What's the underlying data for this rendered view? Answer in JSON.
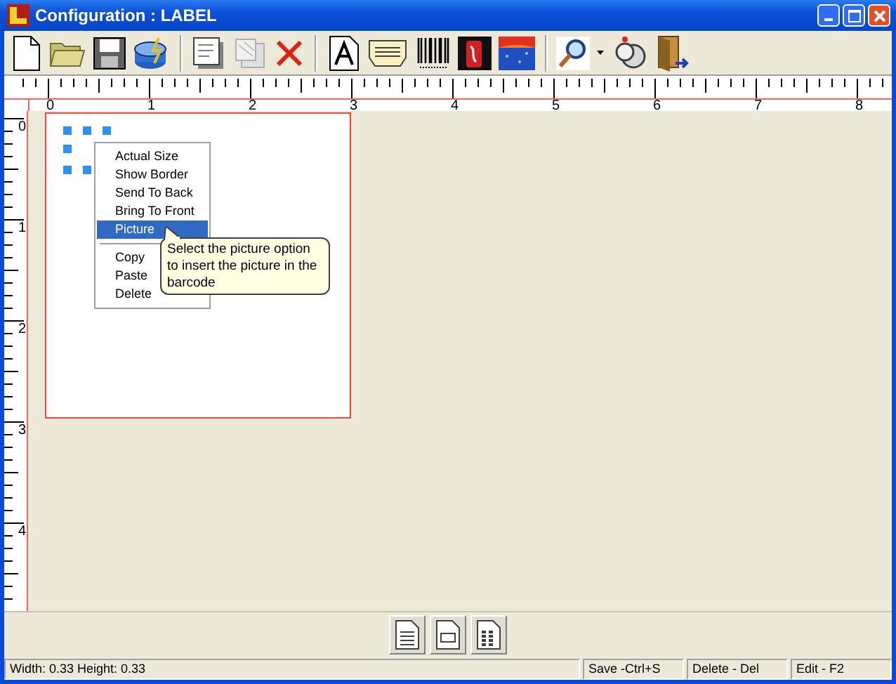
{
  "window": {
    "title": "Configuration : LABEL"
  },
  "ruler_horizontal": {
    "labels": [
      "0",
      "1",
      "2",
      "3",
      "4",
      "5",
      "6",
      "7",
      "8"
    ]
  },
  "ruler_vertical": {
    "labels": [
      "0",
      "1",
      "2",
      "3",
      "4"
    ]
  },
  "context_menu": {
    "items": [
      {
        "kind": "item",
        "label": "Actual Size",
        "selected": false
      },
      {
        "kind": "item",
        "label": "Show Border",
        "selected": false
      },
      {
        "kind": "item",
        "label": "Send To Back",
        "selected": false
      },
      {
        "kind": "item",
        "label": "Bring To Front",
        "selected": false
      },
      {
        "kind": "item",
        "label": "Picture",
        "selected": true
      },
      {
        "kind": "separator"
      },
      {
        "kind": "item",
        "label": "Copy",
        "selected": false
      },
      {
        "kind": "item",
        "label": "Paste",
        "selected": false
      },
      {
        "kind": "item",
        "label": "Delete",
        "selected": false
      }
    ]
  },
  "tooltip": {
    "text": "Select the picture option to insert the picture in the barcode"
  },
  "status_bar": [
    "Width: 0.33 Height: 0.33",
    "Save -Ctrl+S",
    "Delete - Del",
    "Edit - F2"
  ]
}
